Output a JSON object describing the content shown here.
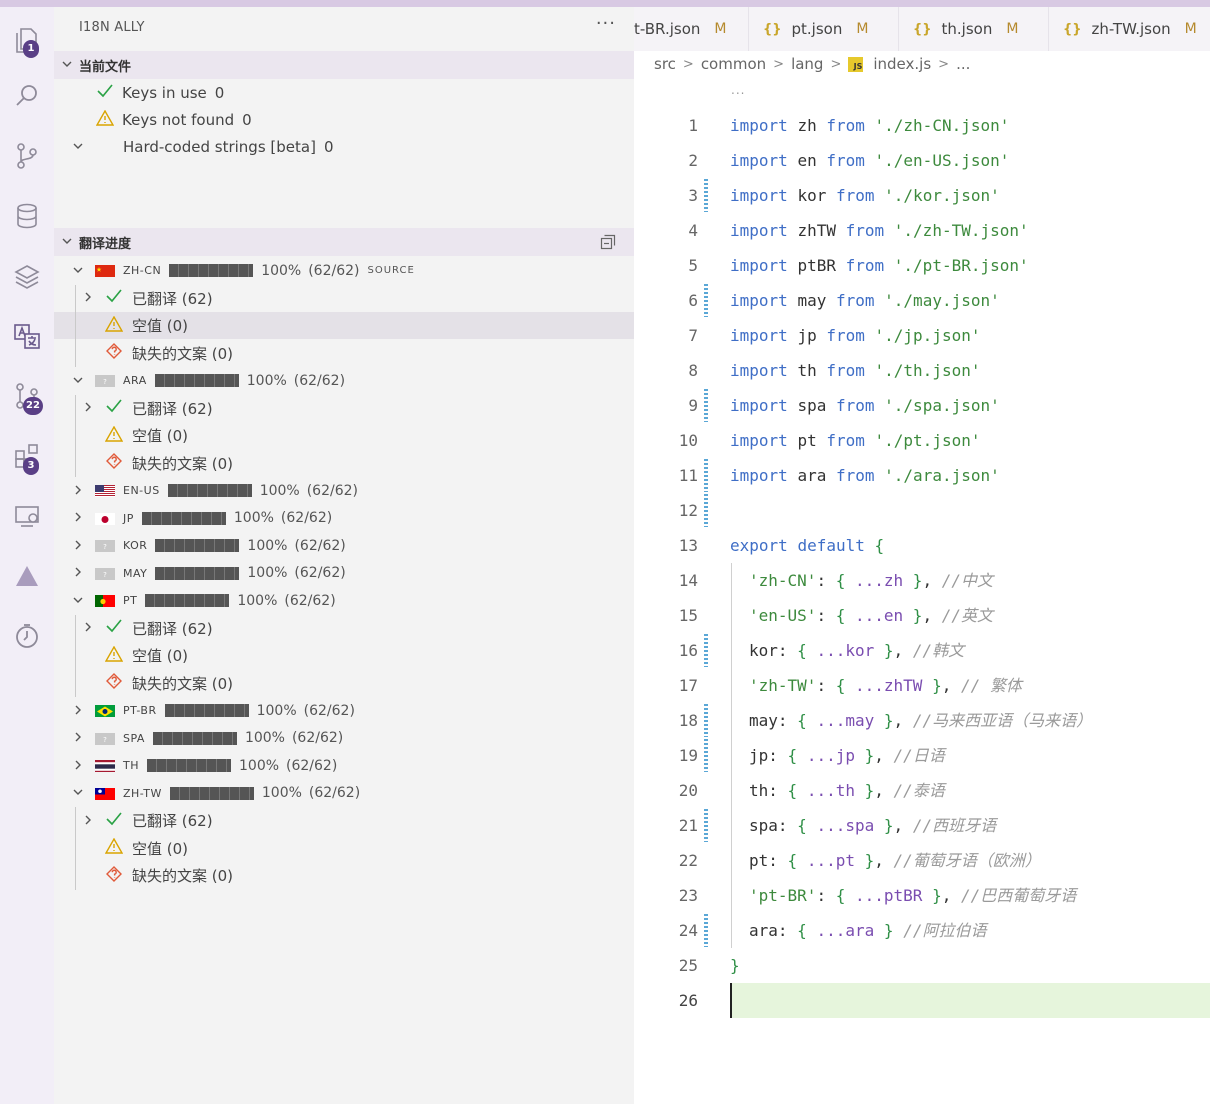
{
  "sidebar": {
    "title": "I18N ALLY",
    "more": "···",
    "current_file": {
      "label": "当前文件",
      "items": [
        {
          "label": "Keys in use",
          "count": "0"
        },
        {
          "label": "Keys not found",
          "count": "0"
        },
        {
          "label": "Hard-coded strings [beta]",
          "count": "0"
        }
      ]
    },
    "progress": {
      "label": "翻译进度",
      "translated_label": "已翻译 (62)",
      "empty_label": "空值 (0)",
      "missing_label": "缺失的文案 (0)",
      "percent": "100%",
      "count": "(62/62)",
      "source_tag": "SOURCE",
      "locales": [
        {
          "code": "ZH-CN",
          "flag": "cn",
          "expanded": true
        },
        {
          "code": "ARA",
          "flag": "unknown",
          "expanded": true
        },
        {
          "code": "EN-US",
          "flag": "us",
          "expanded": false
        },
        {
          "code": "JP",
          "flag": "jp",
          "expanded": false
        },
        {
          "code": "KOR",
          "flag": "unknown",
          "expanded": false
        },
        {
          "code": "MAY",
          "flag": "unknown",
          "expanded": false
        },
        {
          "code": "PT",
          "flag": "pt",
          "expanded": true
        },
        {
          "code": "PT-BR",
          "flag": "br",
          "expanded": false
        },
        {
          "code": "SPA",
          "flag": "unknown",
          "expanded": false
        },
        {
          "code": "TH",
          "flag": "th",
          "expanded": false
        },
        {
          "code": "ZH-TW",
          "flag": "tw",
          "expanded": true
        }
      ]
    }
  },
  "activity": {
    "badges": {
      "explorer": "1",
      "scm": "22",
      "extensions": "3"
    }
  },
  "editor": {
    "tabs": [
      {
        "label": "t-BR.json",
        "modified": "M"
      },
      {
        "label": "pt.json",
        "modified": "M"
      },
      {
        "label": "th.json",
        "modified": "M"
      },
      {
        "label": "zh-TW.json",
        "modified": "M"
      }
    ],
    "breadcrumb": [
      "src",
      "common",
      "lang",
      "index.js",
      "..."
    ],
    "ellipsis": "...",
    "lines": [
      "import zh from './zh-CN.json'",
      "import en from './en-US.json'",
      "import kor from './kor.json'",
      "import zhTW from './zh-TW.json'",
      "import ptBR from './pt-BR.json'",
      "import may from './may.json'",
      "import jp from './jp.json'",
      "import th from './th.json'",
      "import spa from './spa.json'",
      "import pt from './pt.json'",
      "import ara from './ara.json'",
      "",
      "export default {",
      "'zh-CN': { ...zh }, //中文",
      "'en-US': { ...en }, //英文",
      "kor: { ...kor }, //韩文",
      "'zh-TW': { ...zhTW }, // 繁体",
      "may: { ...may }, //马来西亚语（马来语）",
      "jp: { ...jp }, //日语",
      "th: { ...th }, //泰语",
      "spa: { ...spa }, //西班牙语",
      "pt: { ...pt }, //葡萄牙语（欧洲）",
      "'pt-BR': { ...ptBR }, //巴西葡萄牙语",
      "ara: { ...ara } //阿拉伯语",
      "}",
      ""
    ],
    "changed_lines": [
      3,
      6,
      9,
      11,
      12,
      16,
      18,
      19,
      21,
      24
    ],
    "active_line": 26
  }
}
